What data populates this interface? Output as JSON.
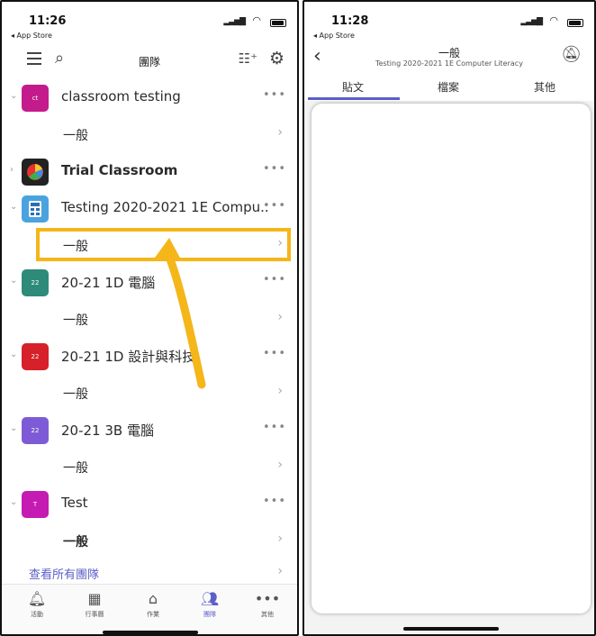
{
  "left": {
    "status": {
      "time": "11:26",
      "back_app": "◂ App Store"
    },
    "header": {
      "title": "團隊"
    },
    "teams": [
      {
        "initials": "ct",
        "color": "#c41b8c",
        "name": "classroom testing",
        "bold": false,
        "channel": "一般",
        "channel_bold": false
      },
      {
        "initials": "",
        "color": "#222222",
        "name": "Trial Classroom",
        "bold": true,
        "channel": null
      },
      {
        "initials": "",
        "color": "#4aa3df",
        "name": "Testing 2020-2021 1E Compu...",
        "bold": false,
        "channel": "一般",
        "channel_bold": false
      },
      {
        "initials": "22",
        "color": "#2e8b7a",
        "name": "20-21 1D 電腦",
        "bold": false,
        "channel": "一般",
        "channel_bold": false
      },
      {
        "initials": "22",
        "color": "#d6202a",
        "name": "20-21 1D 設計與科技",
        "bold": false,
        "channel": "一般",
        "channel_bold": false
      },
      {
        "initials": "22",
        "color": "#7e5bd6",
        "name": "20-21 3B 電腦",
        "bold": false,
        "channel": "一般",
        "channel_bold": false
      },
      {
        "initials": "T",
        "color": "#c41bb2",
        "name": "Test",
        "bold": false,
        "channel": "一般",
        "channel_bold": true
      }
    ],
    "see_all": "查看所有團隊",
    "tabbar": [
      {
        "label": "活動",
        "icon": "bell-icon"
      },
      {
        "label": "行事曆",
        "icon": "calendar-icon"
      },
      {
        "label": "作業",
        "icon": "backpack-icon"
      },
      {
        "label": "團隊",
        "icon": "teams-icon",
        "active": true
      },
      {
        "label": "其他",
        "icon": "more-icon"
      }
    ],
    "highlight_color": "#f4b619"
  },
  "right": {
    "status": {
      "time": "11:28",
      "back_app": "◂ App Store"
    },
    "header": {
      "title": "一般",
      "subtitle": "Testing 2020-2021 1E Computer Literacy"
    },
    "tabs": [
      "貼文",
      "檔案",
      "其他"
    ],
    "accent": "#5b5fc7"
  }
}
